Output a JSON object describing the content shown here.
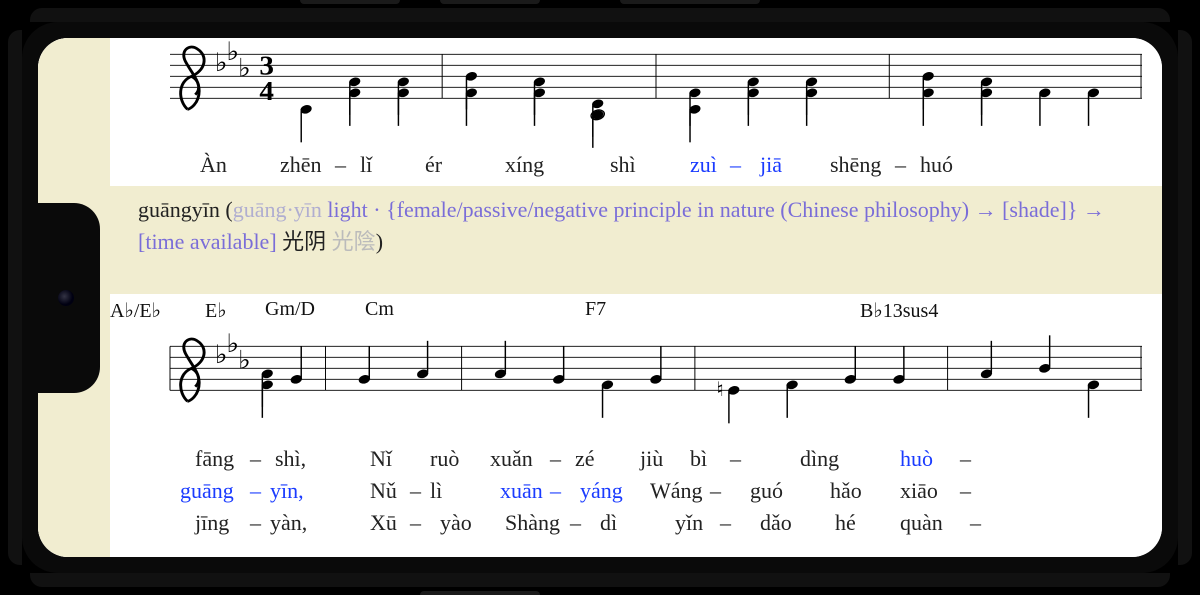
{
  "clef": "treble",
  "keysig": "3 flats (E♭)",
  "timesig": "3/4",
  "staff1": {
    "notes": [
      {
        "beat": 1,
        "pitch": "G3"
      },
      {
        "beat": 2,
        "pitch": "B♭3/D4"
      },
      {
        "beat": 3,
        "pitch": "B♭3/D4"
      },
      {
        "beat": 4,
        "pitch": "B♭3/E♭4"
      },
      {
        "beat": 5,
        "pitch": "B♭3/D4"
      },
      {
        "beat": 6,
        "pitch": "F3/A♭3 (half)"
      },
      {
        "beat": 7,
        "pitch": "G3/B♭3"
      },
      {
        "beat": 8,
        "pitch": "B♭3/D4"
      },
      {
        "beat": 9,
        "pitch": "B♭3/D4"
      },
      {
        "beat": 10,
        "pitch": "B♭3/E♭4"
      },
      {
        "beat": 11,
        "pitch": "B♭3/D4"
      },
      {
        "beat": 12,
        "pitch": "B♭3 (eighth pair)"
      }
    ],
    "lyrics": [
      {
        "t": "Àn",
        "hl": false
      },
      {
        "t": "zhēn",
        "hl": false
      },
      {
        "t": "–",
        "hl": false
      },
      {
        "t": "lǐ",
        "hl": false
      },
      {
        "t": "ér",
        "hl": false
      },
      {
        "t": "xíng",
        "hl": false
      },
      {
        "t": "shì",
        "hl": false
      },
      {
        "t": "zuì",
        "hl": true
      },
      {
        "t": "–",
        "hl": true
      },
      {
        "t": "jiā",
        "hl": true
      },
      {
        "t": "shēng",
        "hl": false
      },
      {
        "t": "–",
        "hl": false
      },
      {
        "t": "huó",
        "hl": false
      }
    ]
  },
  "definition": {
    "head": "guāngyīn",
    "paren_open": " (",
    "mid": "guāng·yīn ",
    "def": "light · {female/passive/negative principle in nature (Chinese philosophy) → [shade]} → [time available] ",
    "han": "光阴 ",
    "han2": "光陰",
    "paren_close": ")"
  },
  "chords": [
    "A♭/E♭",
    "E♭",
    "Gm/D",
    "Cm",
    "F7",
    "B♭13sus4"
  ],
  "chord_pos": [
    0,
    95,
    155,
    255,
    475,
    750
  ],
  "staff2": {
    "notes": [
      {
        "pitch": "B♭3/D4 C4"
      },
      {
        "pitch": "C4. D4(8th)"
      },
      {
        "pitch": "D4 C4 B♭3 C4"
      },
      {
        "pitch": "A3♮ B♭3 C4"
      },
      {
        "pitch": "D4 E♭4 D4. B♭3(8th)"
      }
    ],
    "lyrics_rows": [
      [
        {
          "t": "fāng",
          "hl": false
        },
        {
          "t": "–",
          "hl": false
        },
        {
          "t": "shì,",
          "hl": false
        },
        {
          "t": "Nǐ",
          "hl": false
        },
        {
          "t": "ruò",
          "hl": false
        },
        {
          "t": "xuǎn",
          "hl": false
        },
        {
          "t": "–",
          "hl": false
        },
        {
          "t": "zé",
          "hl": false
        },
        {
          "t": "jiù",
          "hl": false
        },
        {
          "t": "bì",
          "hl": false
        },
        {
          "t": "–",
          "hl": false
        },
        {
          "t": "dìng",
          "hl": false
        },
        {
          "t": "huò",
          "hl": true
        },
        {
          "t": "–",
          "hl": false
        }
      ],
      [
        {
          "t": "guāng",
          "hl": true
        },
        {
          "t": "–",
          "hl": true
        },
        {
          "t": "yīn,",
          "hl": true
        },
        {
          "t": "Nǔ",
          "hl": false
        },
        {
          "t": "–",
          "hl": false
        },
        {
          "t": "lì",
          "hl": false
        },
        {
          "t": "xuān",
          "hl": true
        },
        {
          "t": "–",
          "hl": true
        },
        {
          "t": "yáng",
          "hl": true
        },
        {
          "t": "Wáng",
          "hl": false
        },
        {
          "t": "–",
          "hl": false
        },
        {
          "t": "guó",
          "hl": false
        },
        {
          "t": "hǎo",
          "hl": false
        },
        {
          "t": "xiāo",
          "hl": false
        },
        {
          "t": "–",
          "hl": false
        }
      ],
      [
        {
          "t": "jīng",
          "hl": false
        },
        {
          "t": "–",
          "hl": false
        },
        {
          "t": "yàn,",
          "hl": false
        },
        {
          "t": "Xū",
          "hl": false
        },
        {
          "t": "–",
          "hl": false
        },
        {
          "t": "yào",
          "hl": false
        },
        {
          "t": "Shàng",
          "hl": false
        },
        {
          "t": "–",
          "hl": false
        },
        {
          "t": "dì",
          "hl": false
        },
        {
          "t": "yǐn",
          "hl": false
        },
        {
          "t": "–",
          "hl": false
        },
        {
          "t": "dǎo",
          "hl": false
        },
        {
          "t": "hé",
          "hl": false
        },
        {
          "t": "quàn",
          "hl": false
        },
        {
          "t": "–",
          "hl": false
        }
      ]
    ]
  }
}
